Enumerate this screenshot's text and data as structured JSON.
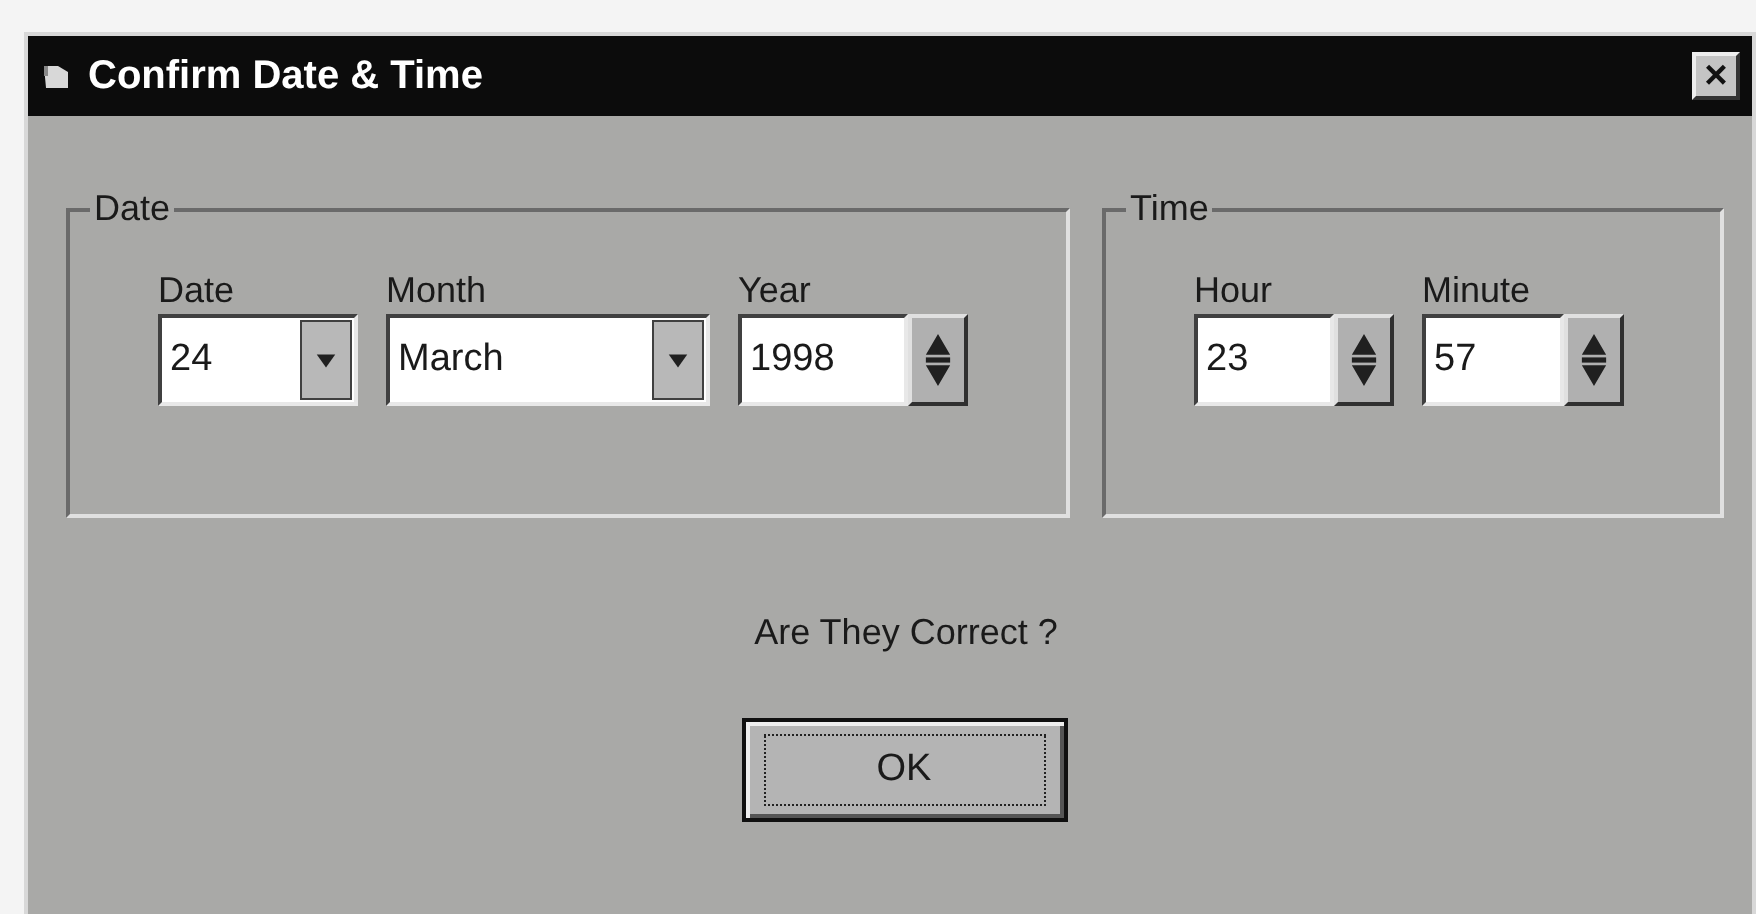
{
  "window": {
    "title": "Confirm Date & Time",
    "close": "×"
  },
  "groups": [
    {
      "title": "Date",
      "fields": [
        {
          "label": "Date",
          "value": "24",
          "kind": "combo"
        },
        {
          "label": "Month",
          "value": "March",
          "kind": "combo"
        },
        {
          "label": "Year",
          "value": "1998",
          "kind": "spinner"
        }
      ]
    },
    {
      "title": "Time",
      "fields": [
        {
          "label": "Hour",
          "value": "23",
          "kind": "spinner"
        },
        {
          "label": "Minute",
          "value": "57",
          "kind": "spinner"
        }
      ]
    }
  ],
  "prompt": "Are They Correct ?",
  "button": {
    "label": "OK"
  }
}
